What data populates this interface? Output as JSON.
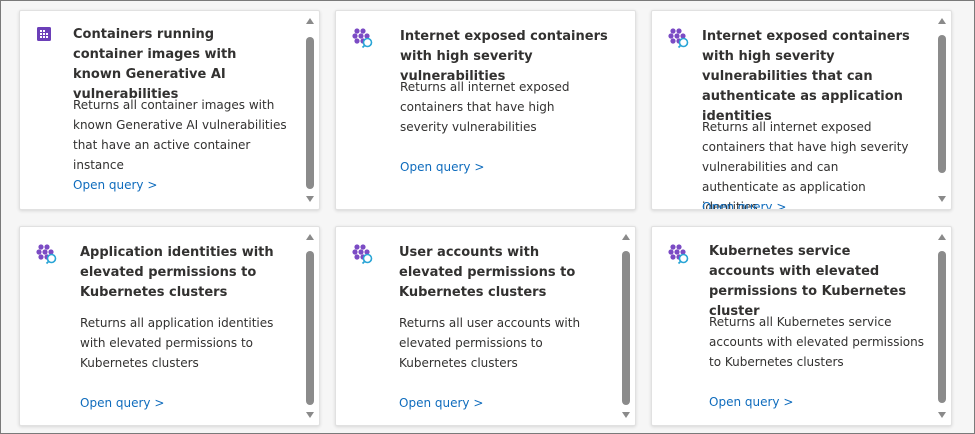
{
  "cards": [
    {
      "title": "Containers running container images with known Generative AI vulnerabilities",
      "description": "Returns all container images with known Generative AI vulnerabilities that have an active container instance",
      "link": "Open query >"
    },
    {
      "title": "Internet exposed containers with high severity vulnerabilities",
      "description": "Returns all internet exposed containers that have high severity vulnerabilities",
      "link": "Open query >"
    },
    {
      "title": "Internet exposed containers with high severity vulnerabilities that can authenticate as application identities",
      "description": "Returns all internet exposed containers that have high severity vulnerabilities and can authenticate as application identities",
      "link": "Open query >"
    },
    {
      "title": "Application identities with elevated permissions to Kubernetes clusters",
      "description": "Returns all application identities with elevated permissions to Kubernetes clusters",
      "link": "Open query >"
    },
    {
      "title": "User accounts with elevated permissions to Kubernetes clusters",
      "description": "Returns all user accounts with elevated permissions to Kubernetes clusters",
      "link": "Open query >"
    },
    {
      "title": "Kubernetes service accounts with elevated permissions to Kubernetes cluster",
      "description": "Returns all Kubernetes service accounts with elevated permissions to Kubernetes clusters",
      "link": "Open query >"
    }
  ],
  "colors": {
    "link": "#0f6cbd",
    "icon_purple": "#7b4bc4",
    "icon_square": "#6b3fb8"
  },
  "icons": [
    "grid-square-icon",
    "containers-search-icon",
    "containers-search-icon",
    "containers-search-icon",
    "containers-search-icon",
    "containers-search-icon"
  ]
}
